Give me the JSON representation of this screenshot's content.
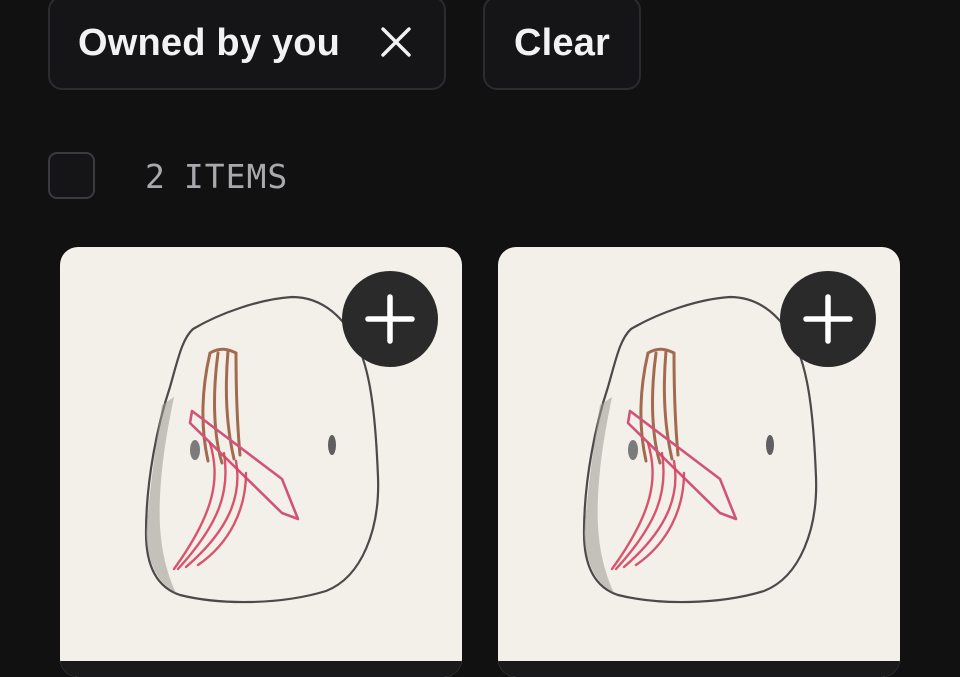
{
  "filters": {
    "owned_label": "Owned by you",
    "close_icon": "close-icon",
    "clear_label": "Clear"
  },
  "results": {
    "count": "2",
    "unit": "ITEMS"
  },
  "items": [
    {
      "thumbnail": "pebble-drawing",
      "add_icon": "plus-icon"
    },
    {
      "thumbnail": "pebble-drawing",
      "add_icon": "plus-icon"
    }
  ],
  "colors": {
    "background": "#111112",
    "chip_border": "#2c2c30",
    "card_bg": "#f3f0ea",
    "add_button_bg": "#2a2a2b"
  }
}
